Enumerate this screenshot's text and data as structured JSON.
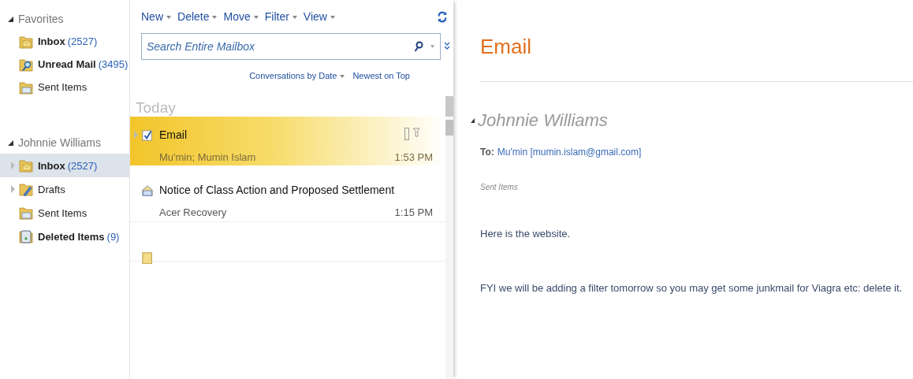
{
  "sidebar": {
    "sections": [
      {
        "title": "Favorites",
        "expanded": true,
        "folders": [
          {
            "name": "Inbox",
            "count": "(2527)",
            "kind": "inbox",
            "unread": true,
            "selected": false,
            "has_children": false
          },
          {
            "name": "Unread Mail",
            "count": "(3495)",
            "kind": "search",
            "unread": true,
            "selected": false,
            "has_children": false
          },
          {
            "name": "Sent Items",
            "kind": "sent",
            "unread": false,
            "selected": false,
            "has_children": false
          }
        ]
      },
      {
        "title": "Johnnie Williams",
        "expanded": true,
        "folders": [
          {
            "name": "Inbox",
            "count": "(2527)",
            "kind": "inbox",
            "unread": true,
            "selected": true,
            "has_children": true
          },
          {
            "name": "Drafts",
            "kind": "drafts",
            "unread": false,
            "selected": false,
            "has_children": true
          },
          {
            "name": "Sent Items",
            "kind": "sent",
            "unread": false,
            "selected": false,
            "has_children": false
          },
          {
            "name": "Deleted Items",
            "count": "(9)",
            "kind": "deleted",
            "unread": true,
            "selected": false,
            "has_children": false
          }
        ]
      }
    ]
  },
  "toolbar": [
    "New",
    "Delete",
    "Move",
    "Filter",
    "View"
  ],
  "search": {
    "placeholder": "Search Entire Mailbox"
  },
  "sort": {
    "arrange": "Conversations by Date",
    "order": "Newest on Top"
  },
  "group": "Today",
  "messages": [
    {
      "subject": "Email",
      "from": "Mu'min; Mumin Islam",
      "time": "1:53 PM",
      "kind": "check",
      "selected": true
    },
    {
      "subject": "Notice of Class Action and Proposed Settlement",
      "from": "Acer Recovery",
      "time": "1:15 PM",
      "kind": "envelope",
      "selected": false
    },
    {
      "kind": "note",
      "selected": false
    }
  ],
  "reading": {
    "title": "Email",
    "sender": "Johnnie Williams",
    "to_label": "To:",
    "recipient": "Mu'min [mumin.islam@gmail.com]",
    "folder": "Sent Items",
    "body": [
      "Here is the website.",
      "FYI we will be adding a filter tomorrow  so you may get some junkmail for Viagra etc: delete it."
    ]
  }
}
